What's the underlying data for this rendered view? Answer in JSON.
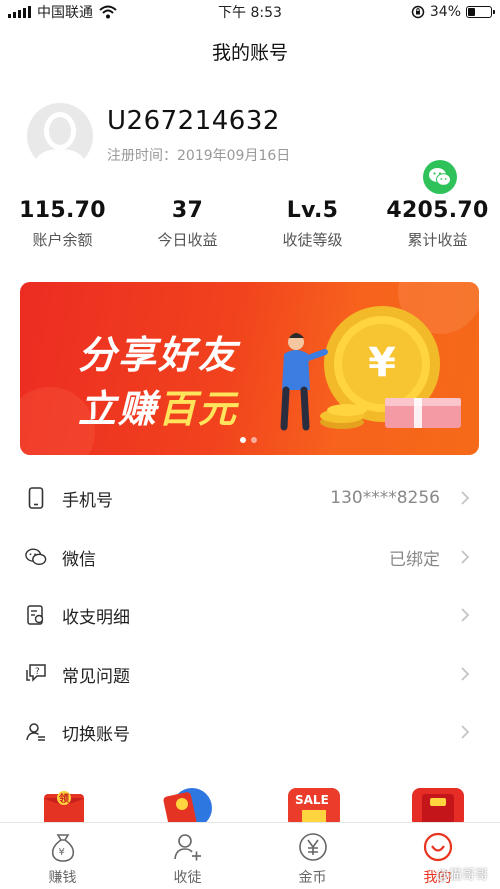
{
  "status_bar": {
    "carrier": "中国联通",
    "time": "下午 8:53",
    "battery": "34%",
    "battery_level": 0.34
  },
  "header": {
    "title": "我的账号"
  },
  "profile": {
    "user_id": "U267214632",
    "register_label": "注册时间：2019年09月16日"
  },
  "stats": [
    {
      "value": "115.70",
      "label": "账户余额"
    },
    {
      "value": "37",
      "label": "今日收益"
    },
    {
      "value": "Lv.5",
      "label": "收徒等级"
    },
    {
      "value": "4205.70",
      "label": "累计收益"
    }
  ],
  "banner": {
    "line1": "分享好友",
    "line2_prefix": "立赚",
    "line2_highlight": "百元",
    "coin_symbol": "¥"
  },
  "menu": [
    {
      "label": "手机号",
      "value": "130****8256",
      "icon": "phone-icon"
    },
    {
      "label": "微信",
      "value": "已绑定",
      "icon": "wechat-icon"
    },
    {
      "label": "收支明细",
      "value": "",
      "icon": "ledger-icon"
    },
    {
      "label": "常见问题",
      "value": "",
      "icon": "faq-icon"
    },
    {
      "label": "切换账号",
      "value": "",
      "icon": "switch-account-icon"
    }
  ],
  "promos": {
    "promo3_text": "SALE",
    "promo1_text": "领"
  },
  "tabs": [
    {
      "label": "赚钱",
      "icon": "money-bag-icon"
    },
    {
      "label": "收徒",
      "icon": "add-user-icon"
    },
    {
      "label": "金币",
      "icon": "coin-icon"
    },
    {
      "label": "我的",
      "icon": "smile-icon"
    }
  ],
  "watermark": "@猫哥哥",
  "colors": {
    "accent": "#e8341f",
    "banner_start": "#ec2c22",
    "banner_end": "#f56a18",
    "wechat_green": "#2fc25b"
  }
}
